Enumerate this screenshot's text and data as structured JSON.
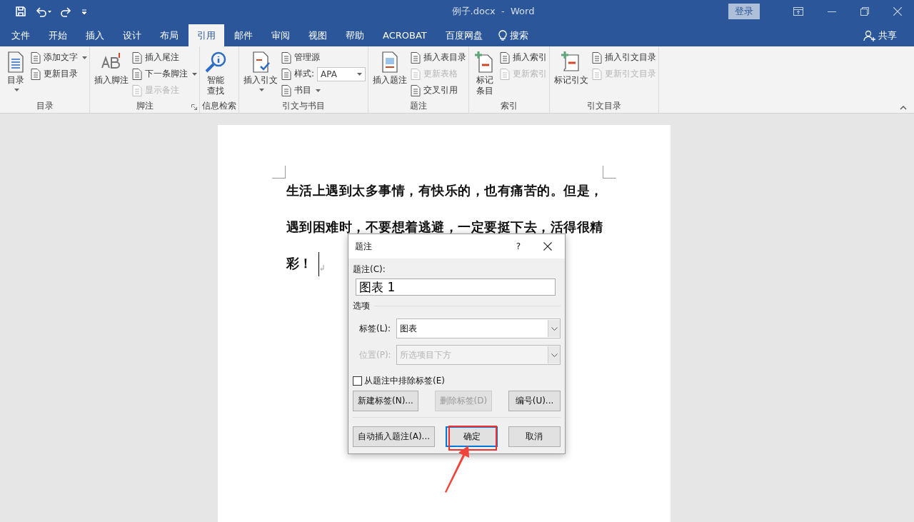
{
  "title_bar": {
    "title": "例子.docx  -  Word",
    "sign_in": "登录"
  },
  "menu_tabs": [
    {
      "label": "文件",
      "selected": false
    },
    {
      "label": "开始",
      "selected": false
    },
    {
      "label": "插入",
      "selected": false
    },
    {
      "label": "设计",
      "selected": false
    },
    {
      "label": "布局",
      "selected": false
    },
    {
      "label": "引用",
      "selected": true
    },
    {
      "label": "邮件",
      "selected": false
    },
    {
      "label": "审阅",
      "selected": false
    },
    {
      "label": "视图",
      "selected": false
    },
    {
      "label": "帮助",
      "selected": false
    },
    {
      "label": "ACROBAT",
      "selected": false
    },
    {
      "label": "百度网盘",
      "selected": false
    }
  ],
  "tell_me": "搜索",
  "share": "共享",
  "ribbon_groups": [
    {
      "label": "目录",
      "commands": [
        {
          "kind": "large",
          "label": "目录",
          "dropdown": true,
          "disabled": false
        },
        {
          "kind": "small",
          "label": "添加文字",
          "dropdown": true,
          "disabled": false
        },
        {
          "kind": "small",
          "label": "更新目录",
          "dropdown": false,
          "disabled": false
        }
      ]
    },
    {
      "label": "脚注",
      "launcher": true,
      "commands": [
        {
          "kind": "large",
          "label": "插入脚注",
          "dropdown": false,
          "disabled": false
        },
        {
          "kind": "small",
          "label": "插入尾注",
          "dropdown": false,
          "disabled": false
        },
        {
          "kind": "small",
          "label": "下一条脚注",
          "dropdown": true,
          "disabled": false
        },
        {
          "kind": "small",
          "label": "显示备注",
          "dropdown": false,
          "disabled": true
        }
      ]
    },
    {
      "label": "信息检索",
      "commands": [
        {
          "kind": "tall",
          "label": "智能查找",
          "dropdown": false,
          "disabled": false
        }
      ]
    },
    {
      "label": "引文与书目",
      "commands": [
        {
          "kind": "large",
          "label": "插入引文",
          "dropdown": true,
          "disabled": false
        },
        {
          "kind": "small",
          "label": "管理源",
          "dropdown": false,
          "disabled": false
        },
        {
          "kind": "combo",
          "label": "样式:",
          "value": "APA",
          "dropdown": true,
          "disabled": false
        },
        {
          "kind": "small",
          "label": "书目",
          "dropdown": true,
          "disabled": false
        }
      ]
    },
    {
      "label": "题注",
      "commands": [
        {
          "kind": "large",
          "label": "插入题注",
          "dropdown": false,
          "disabled": false
        },
        {
          "kind": "small",
          "label": "插入表目录",
          "dropdown": false,
          "disabled": false
        },
        {
          "kind": "small",
          "label": "更新表格",
          "dropdown": false,
          "disabled": true
        },
        {
          "kind": "small",
          "label": "交叉引用",
          "dropdown": false,
          "disabled": false
        }
      ]
    },
    {
      "label": "索引",
      "commands": [
        {
          "kind": "tall",
          "label": "标记条目",
          "dropdown": false,
          "disabled": false
        },
        {
          "kind": "small",
          "label": "插入索引",
          "dropdown": false,
          "disabled": false
        },
        {
          "kind": "small",
          "label": "更新索引",
          "dropdown": false,
          "disabled": true
        }
      ]
    },
    {
      "label": "引文目录",
      "commands": [
        {
          "kind": "large",
          "label": "标记引文",
          "dropdown": false,
          "disabled": false
        },
        {
          "kind": "small",
          "label": "插入引文目录",
          "dropdown": false,
          "disabled": false
        },
        {
          "kind": "small",
          "label": "更新引文目录",
          "dropdown": false,
          "disabled": true
        }
      ]
    }
  ],
  "document": {
    "lines": [
      "生活上遇到太多事情，有快乐的，也有痛苦的。但是，",
      "遇到困难时，不要想着逃避，一定要挺下去，活得很精",
      "彩！"
    ]
  },
  "dialog": {
    "title": "题注",
    "help": "?",
    "caption_label": "题注(C):",
    "caption_value": "图表 1",
    "options_heading": "选项",
    "fields": [
      {
        "label": "标签(L):",
        "value": "图表",
        "disabled": false
      },
      {
        "label": "位置(P):",
        "value": "所选项目下方",
        "disabled": true
      }
    ],
    "checkbox": {
      "label": "从题注中排除标签(E)",
      "checked": false
    },
    "buttons": [
      {
        "label": "新建标签(N)...",
        "disabled": false,
        "default": false
      },
      {
        "label": "删除标签(D)",
        "disabled": true,
        "default": false
      },
      {
        "label": "编号(U)...",
        "disabled": false,
        "default": false
      }
    ],
    "footer_buttons": [
      {
        "label": "自动插入题注(A)...",
        "disabled": false,
        "default": false
      },
      {
        "label": "确定",
        "disabled": false,
        "default": true
      },
      {
        "label": "取消",
        "disabled": false,
        "default": false
      }
    ]
  }
}
